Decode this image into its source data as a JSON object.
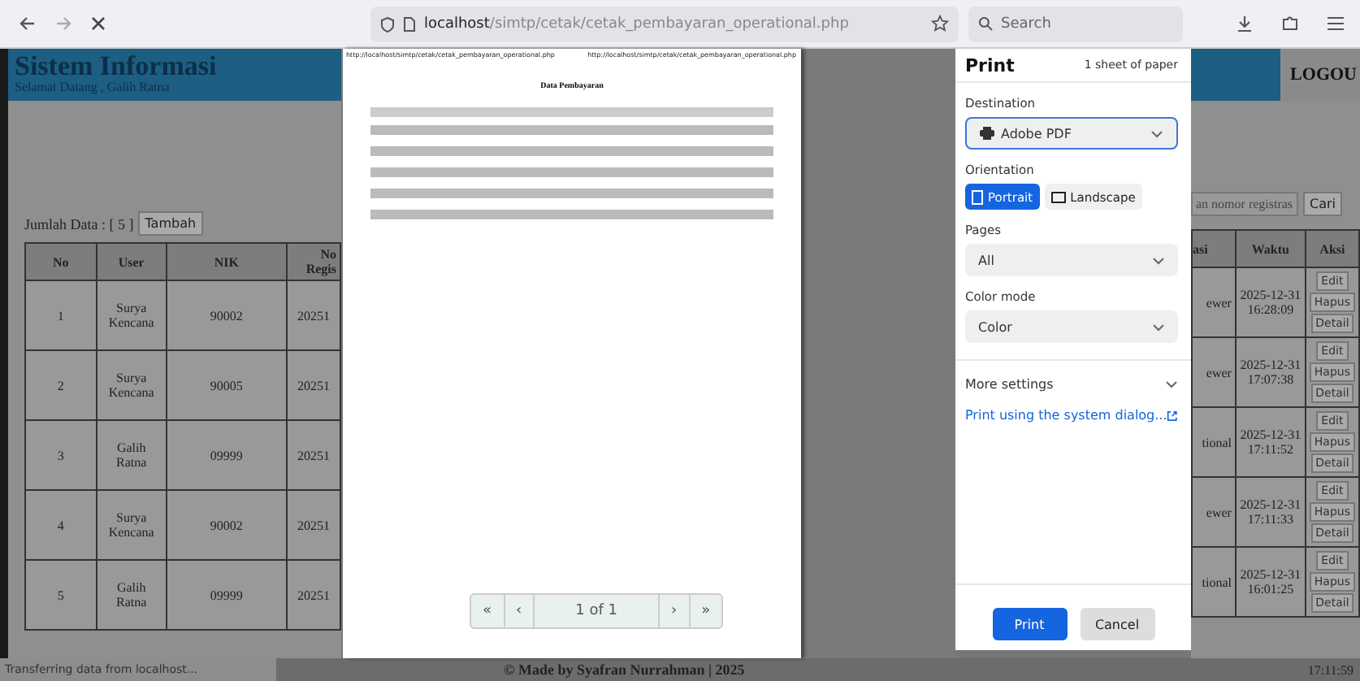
{
  "browser": {
    "url_host": "localhost",
    "url_path": "/simtp/cetak/cetak_pembayaran_operational.php",
    "search_placeholder": "Search"
  },
  "page": {
    "title": "Sistem Informasi",
    "welcome": "Selamat Datang , Galih Ratna",
    "count_label": "Jumlah Data : [ 5 ]",
    "add_button": "Tambah",
    "search_placeholder": "an nomor registras",
    "search_button": "Cari",
    "logout_button": "LOGOU",
    "left_columns": [
      "No",
      "User",
      "NIK",
      "No Regis"
    ],
    "right_columns": [
      "asi",
      "Waktu",
      "Aksi"
    ],
    "rows": [
      {
        "no": "1",
        "user": "Surya Kencana",
        "nik": "90002",
        "reg": "20251",
        "role": "ewer",
        "time": "2025-12-31 16:28:09",
        "actions": [
          "Edit",
          "Hapus",
          "Detail"
        ]
      },
      {
        "no": "2",
        "user": "Surya Kencana",
        "nik": "90005",
        "reg": "20251",
        "role": "ewer",
        "time": "2025-12-31 17:07:38",
        "actions": [
          "Edit",
          "Hapus",
          "Detail"
        ]
      },
      {
        "no": "3",
        "user": "Galih Ratna",
        "nik": "09999",
        "reg": "20251",
        "role": "tional",
        "time": "2025-12-31 17:11:52",
        "actions": [
          "Edit",
          "Hapus",
          "Detail"
        ]
      },
      {
        "no": "4",
        "user": "Surya Kencana",
        "nik": "90002",
        "reg": "20251",
        "role": "ewer",
        "time": "2025-12-31 17:11:33",
        "actions": [
          "Edit",
          "Hapus",
          "Detail"
        ]
      },
      {
        "no": "5",
        "user": "Galih Ratna",
        "nik": "09999",
        "reg": "20251",
        "role": "tional",
        "time": "2025-12-31 16:01:25",
        "actions": [
          "Edit",
          "Hapus",
          "Detail"
        ]
      }
    ],
    "footer": "© Made by Syafran Nurrahman | 2025",
    "clock": "17:11:59"
  },
  "preview": {
    "header_left": "http://localhost/simtp/cetak/cetak_pembayaran_operational.php",
    "header_right": "http://localhost/simtp/cetak/cetak_pembayaran_operational.php",
    "doc_title": "Data Pembayaran",
    "pager": [
      {
        "label": "«",
        "kind": "button"
      },
      {
        "label": "‹",
        "kind": "button"
      },
      {
        "label": "1 of 1",
        "kind": "status"
      },
      {
        "label": "›",
        "kind": "button"
      },
      {
        "label": "»",
        "kind": "button"
      }
    ]
  },
  "print_dialog": {
    "title": "Print",
    "sheets": "1 sheet of paper",
    "destination_label": "Destination",
    "destination": "Adobe PDF",
    "orientation_label": "Orientation",
    "orientations": [
      {
        "label": "Portrait",
        "selected": true
      },
      {
        "label": "Landscape",
        "selected": false
      }
    ],
    "pages_label": "Pages",
    "pages": "All",
    "color_label": "Color mode",
    "color_mode": "Color",
    "more_settings": "More settings",
    "more_expanded": false,
    "system_dialog": "Print using the system dialog...",
    "print_button": "Print",
    "cancel_button": "Cancel"
  },
  "status_bar": "Transferring data from localhost..."
}
